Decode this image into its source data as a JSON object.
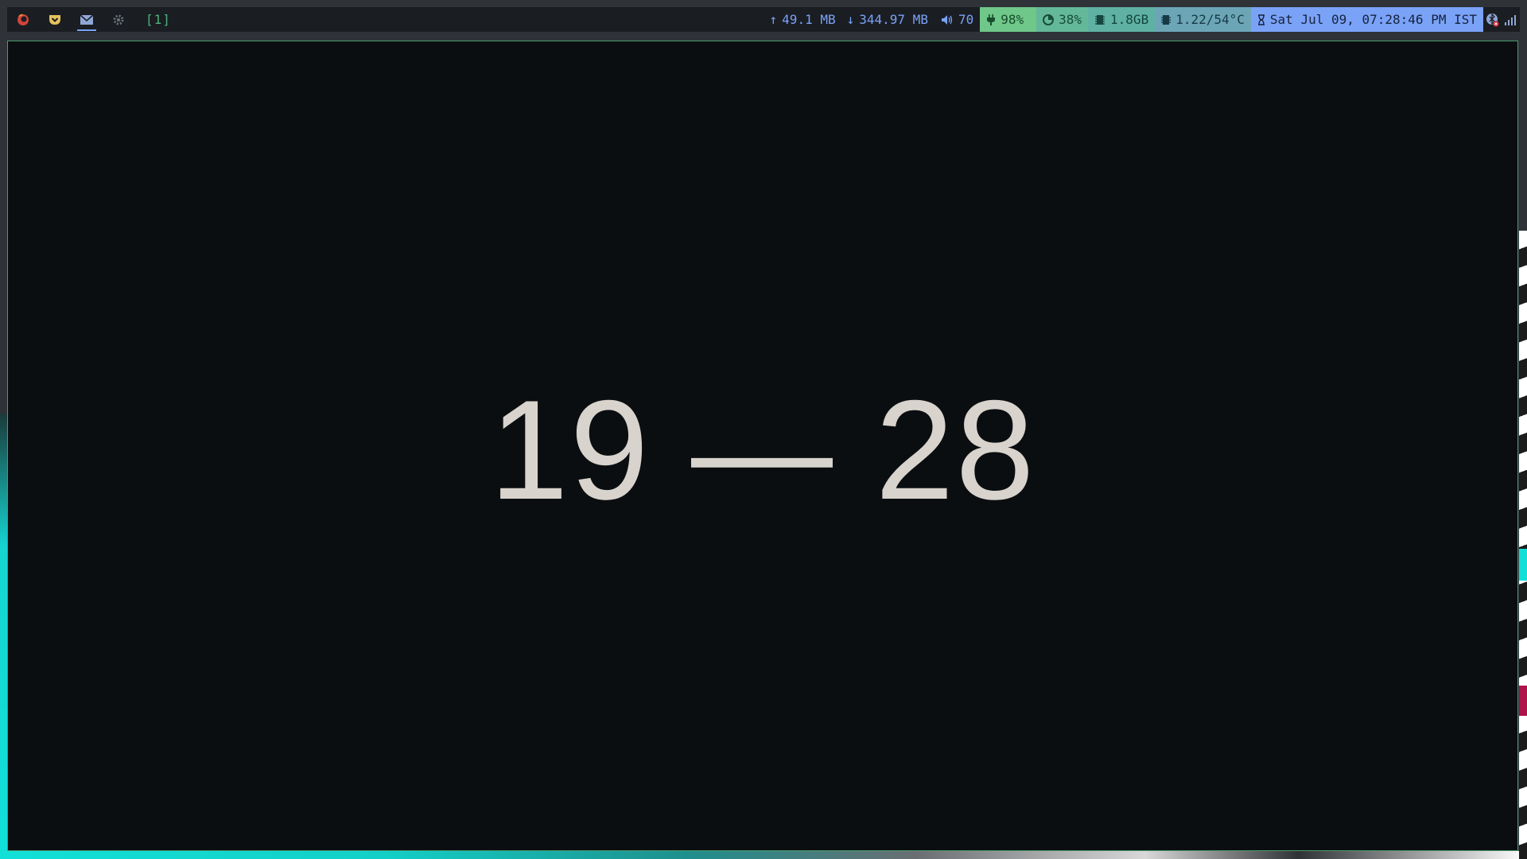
{
  "workspaces": {
    "icons": [
      "firefox-icon",
      "pocket-icon",
      "mail-icon",
      "settings-icon"
    ],
    "active_index": 2,
    "label": "[1]"
  },
  "status": {
    "upload": "49.1 MB",
    "download": "344.97 MB",
    "volume": "70",
    "battery": "98%",
    "cpu": "38%",
    "memory": "1.8GB",
    "load_temp": "1.22/54°C",
    "clock": "Sat Jul 09, 07:28:46 PM IST"
  },
  "terminal": {
    "display": "19 — 28"
  },
  "colors": {
    "bar_bg": "#1a1d22",
    "accent": "#7aa2f7",
    "workspace_label": "#4fb07a",
    "window_border": "#4a9a6e",
    "window_bg": "#0b0e11",
    "text": "#d8d3cc"
  }
}
